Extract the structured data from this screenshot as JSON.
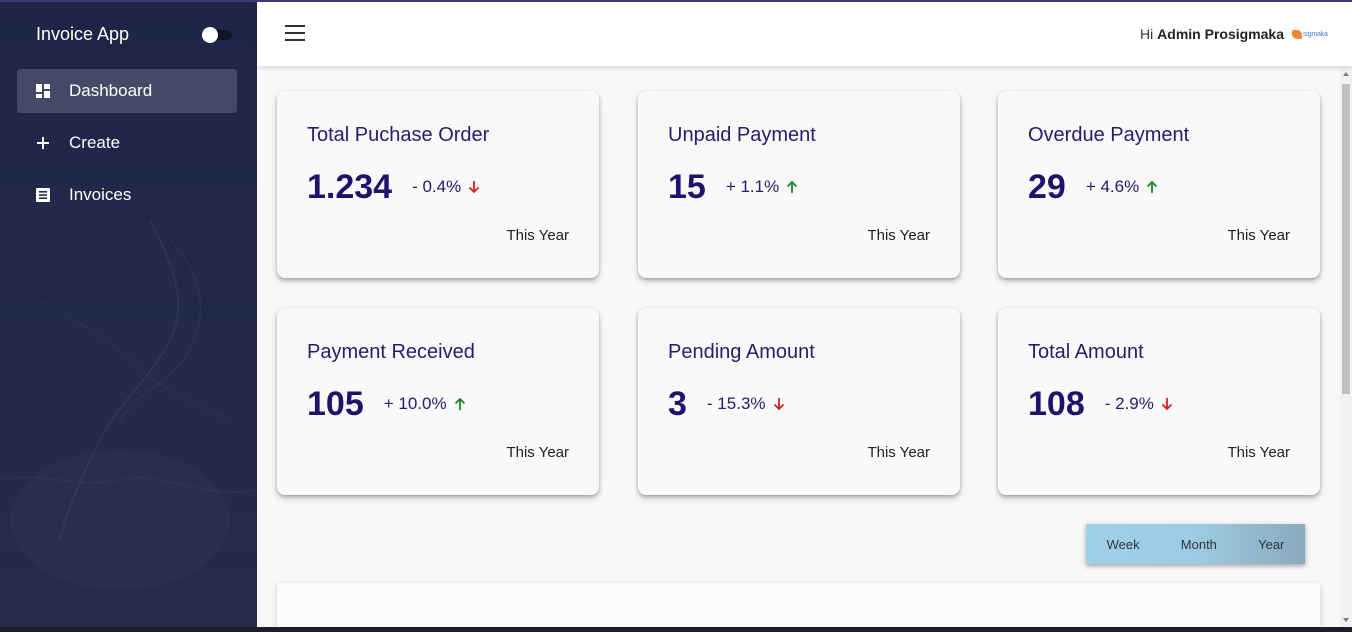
{
  "sidebar": {
    "brand": "Invoice App",
    "items": [
      {
        "label": "Dashboard",
        "icon": "dashboard-icon",
        "active": true
      },
      {
        "label": "Create",
        "icon": "plus-icon",
        "active": false
      },
      {
        "label": "Invoices",
        "icon": "list-icon",
        "active": false
      }
    ]
  },
  "header": {
    "greeting_prefix": "Hi",
    "user_name": "Admin Prosigmaka",
    "logo_word": "sigmaka"
  },
  "cards": [
    {
      "title": "Total Puchase Order",
      "value": "1.234",
      "change": "- 0.4%",
      "direction": "down",
      "period": "This Year"
    },
    {
      "title": "Unpaid Payment",
      "value": "15",
      "change": "+ 1.1%",
      "direction": "up",
      "period": "This Year"
    },
    {
      "title": "Overdue Payment",
      "value": "29",
      "change": "+ 4.6%",
      "direction": "up",
      "period": "This Year"
    },
    {
      "title": "Payment Received",
      "value": "105",
      "change": "+ 10.0%",
      "direction": "up",
      "period": "This Year"
    },
    {
      "title": "Pending Amount",
      "value": "3",
      "change": "- 15.3%",
      "direction": "down",
      "period": "This Year"
    },
    {
      "title": "Total Amount",
      "value": "108",
      "change": "- 2.9%",
      "direction": "down",
      "period": "This Year"
    }
  ],
  "range_buttons": [
    "Week",
    "Month",
    "Year"
  ],
  "colors": {
    "sidebar_bg": "#232a4c",
    "value_text": "#22106b",
    "up_arrow": "#1e8a1e",
    "down_arrow": "#d32020"
  }
}
